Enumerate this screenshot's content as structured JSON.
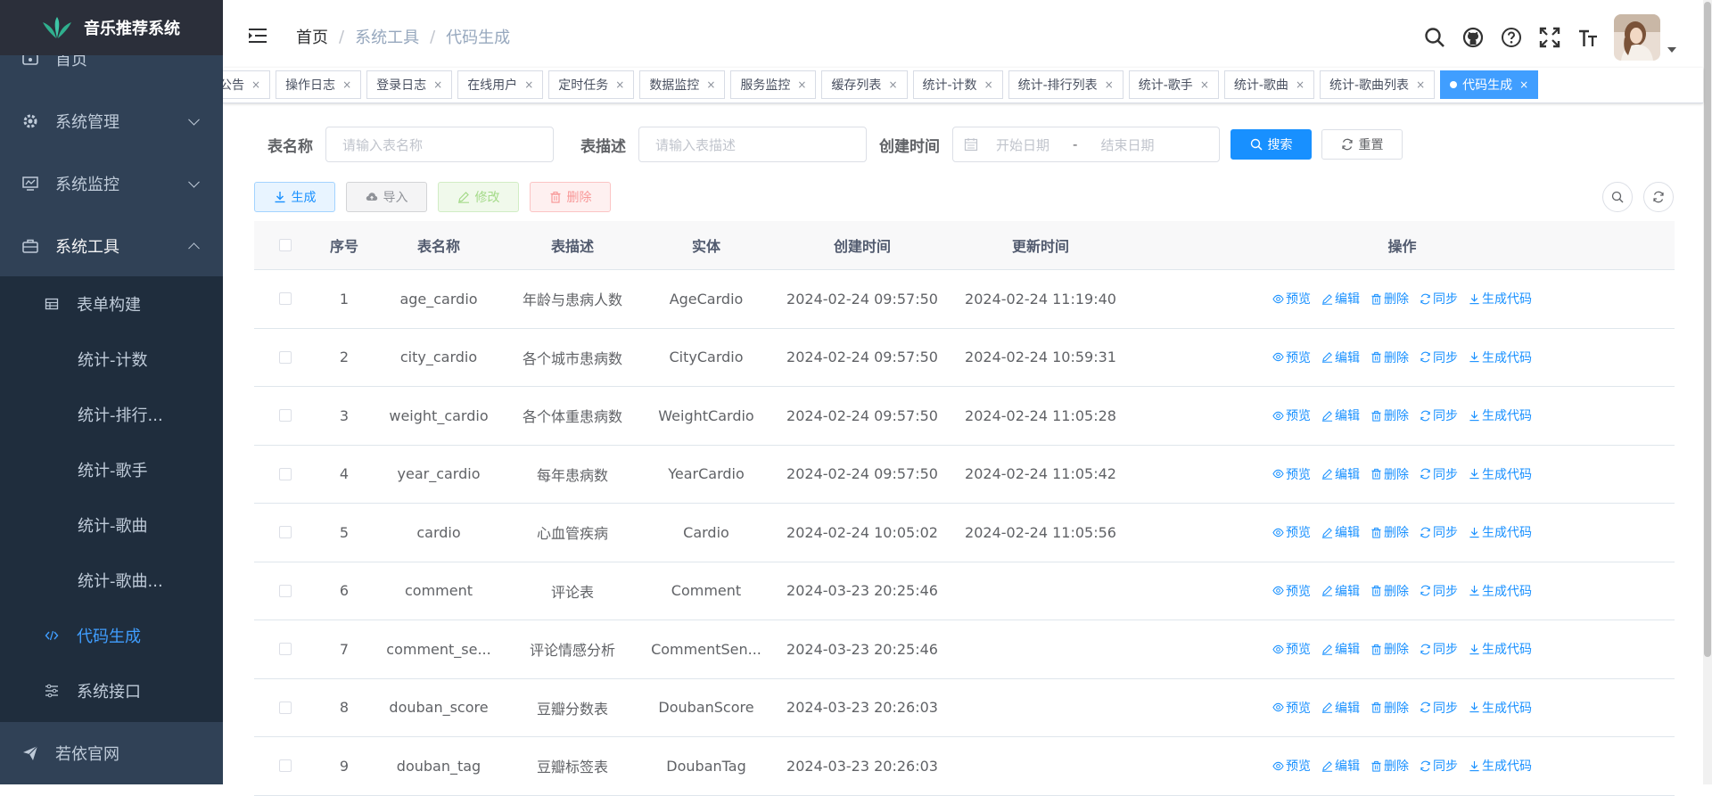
{
  "app": {
    "title": "音乐推荐系统"
  },
  "sidebar": {
    "top_items": [
      {
        "label": "首页",
        "icon": "dashboard-icon"
      },
      {
        "label": "系统管理",
        "icon": "gear-icon"
      },
      {
        "label": "系统监控",
        "icon": "monitor-icon"
      },
      {
        "label": "系统工具",
        "icon": "toolbox-icon"
      }
    ],
    "sub_items": [
      {
        "label": "表单构建",
        "icon": "grid-icon"
      },
      {
        "label": "统计-计数"
      },
      {
        "label": "统计-排行..."
      },
      {
        "label": "统计-歌手"
      },
      {
        "label": "统计-歌曲"
      },
      {
        "label": "统计-歌曲..."
      },
      {
        "label": "代码生成",
        "icon": "code-icon"
      },
      {
        "label": "系统接口",
        "icon": "sliders-icon"
      }
    ],
    "bottom_item": {
      "label": "若依官网",
      "icon": "send-icon"
    }
  },
  "breadcrumb": {
    "home": "首页",
    "level1": "系统工具",
    "level2": "代码生成",
    "sep": "/"
  },
  "tags": [
    "公告",
    "操作日志",
    "登录日志",
    "在线用户",
    "定时任务",
    "数据监控",
    "服务监控",
    "缓存列表",
    "统计-计数",
    "统计-排行列表",
    "统计-歌手",
    "统计-歌曲",
    "统计-歌曲列表",
    "代码生成"
  ],
  "tag_close": "×",
  "search": {
    "table_name_label": "表名称",
    "table_name_placeholder": "请输入表名称",
    "table_desc_label": "表描述",
    "table_desc_placeholder": "请输入表描述",
    "create_time_label": "创建时间",
    "start_placeholder": "开始日期",
    "range_sep": "-",
    "end_placeholder": "结束日期",
    "search_btn": "搜索",
    "reset_btn": "重置"
  },
  "toolbar": {
    "generate": "生成",
    "import": "导入",
    "edit": "修改",
    "delete": "删除"
  },
  "table": {
    "headers": [
      "序号",
      "表名称",
      "表描述",
      "实体",
      "创建时间",
      "更新时间",
      "操作"
    ],
    "ops": [
      "预览",
      "编辑",
      "删除",
      "同步",
      "生成代码"
    ],
    "rows": [
      {
        "no": "1",
        "name": "age_cardio",
        "desc": "年龄与患病人数",
        "entity": "AgeCardio",
        "created": "2024-02-24 09:57:50",
        "updated": "2024-02-24 11:19:40"
      },
      {
        "no": "2",
        "name": "city_cardio",
        "desc": "各个城市患病数",
        "entity": "CityCardio",
        "created": "2024-02-24 09:57:50",
        "updated": "2024-02-24 10:59:31"
      },
      {
        "no": "3",
        "name": "weight_cardio",
        "desc": "各个体重患病数",
        "entity": "WeightCardio",
        "created": "2024-02-24 09:57:50",
        "updated": "2024-02-24 11:05:28"
      },
      {
        "no": "4",
        "name": "year_cardio",
        "desc": "每年患病数",
        "entity": "YearCardio",
        "created": "2024-02-24 09:57:50",
        "updated": "2024-02-24 11:05:42"
      },
      {
        "no": "5",
        "name": "cardio",
        "desc": "心血管疾病",
        "entity": "Cardio",
        "created": "2024-02-24 10:05:02",
        "updated": "2024-02-24 11:05:56"
      },
      {
        "no": "6",
        "name": "comment",
        "desc": "评论表",
        "entity": "Comment",
        "created": "2024-03-23 20:25:46",
        "updated": ""
      },
      {
        "no": "7",
        "name": "comment_se...",
        "desc": "评论情感分析",
        "entity": "CommentSen...",
        "created": "2024-03-23 20:25:46",
        "updated": ""
      },
      {
        "no": "8",
        "name": "douban_score",
        "desc": "豆瓣分数表",
        "entity": "DoubanScore",
        "created": "2024-03-23 20:26:03",
        "updated": ""
      },
      {
        "no": "9",
        "name": "douban_tag",
        "desc": "豆瓣标签表",
        "entity": "DoubanTag",
        "created": "2024-03-23 20:26:03",
        "updated": ""
      }
    ]
  },
  "colors": {
    "sidebar_bg": "#304156",
    "submenu_bg": "#1f2d3d",
    "accent": "#409eff",
    "primary": "#1890ff"
  }
}
